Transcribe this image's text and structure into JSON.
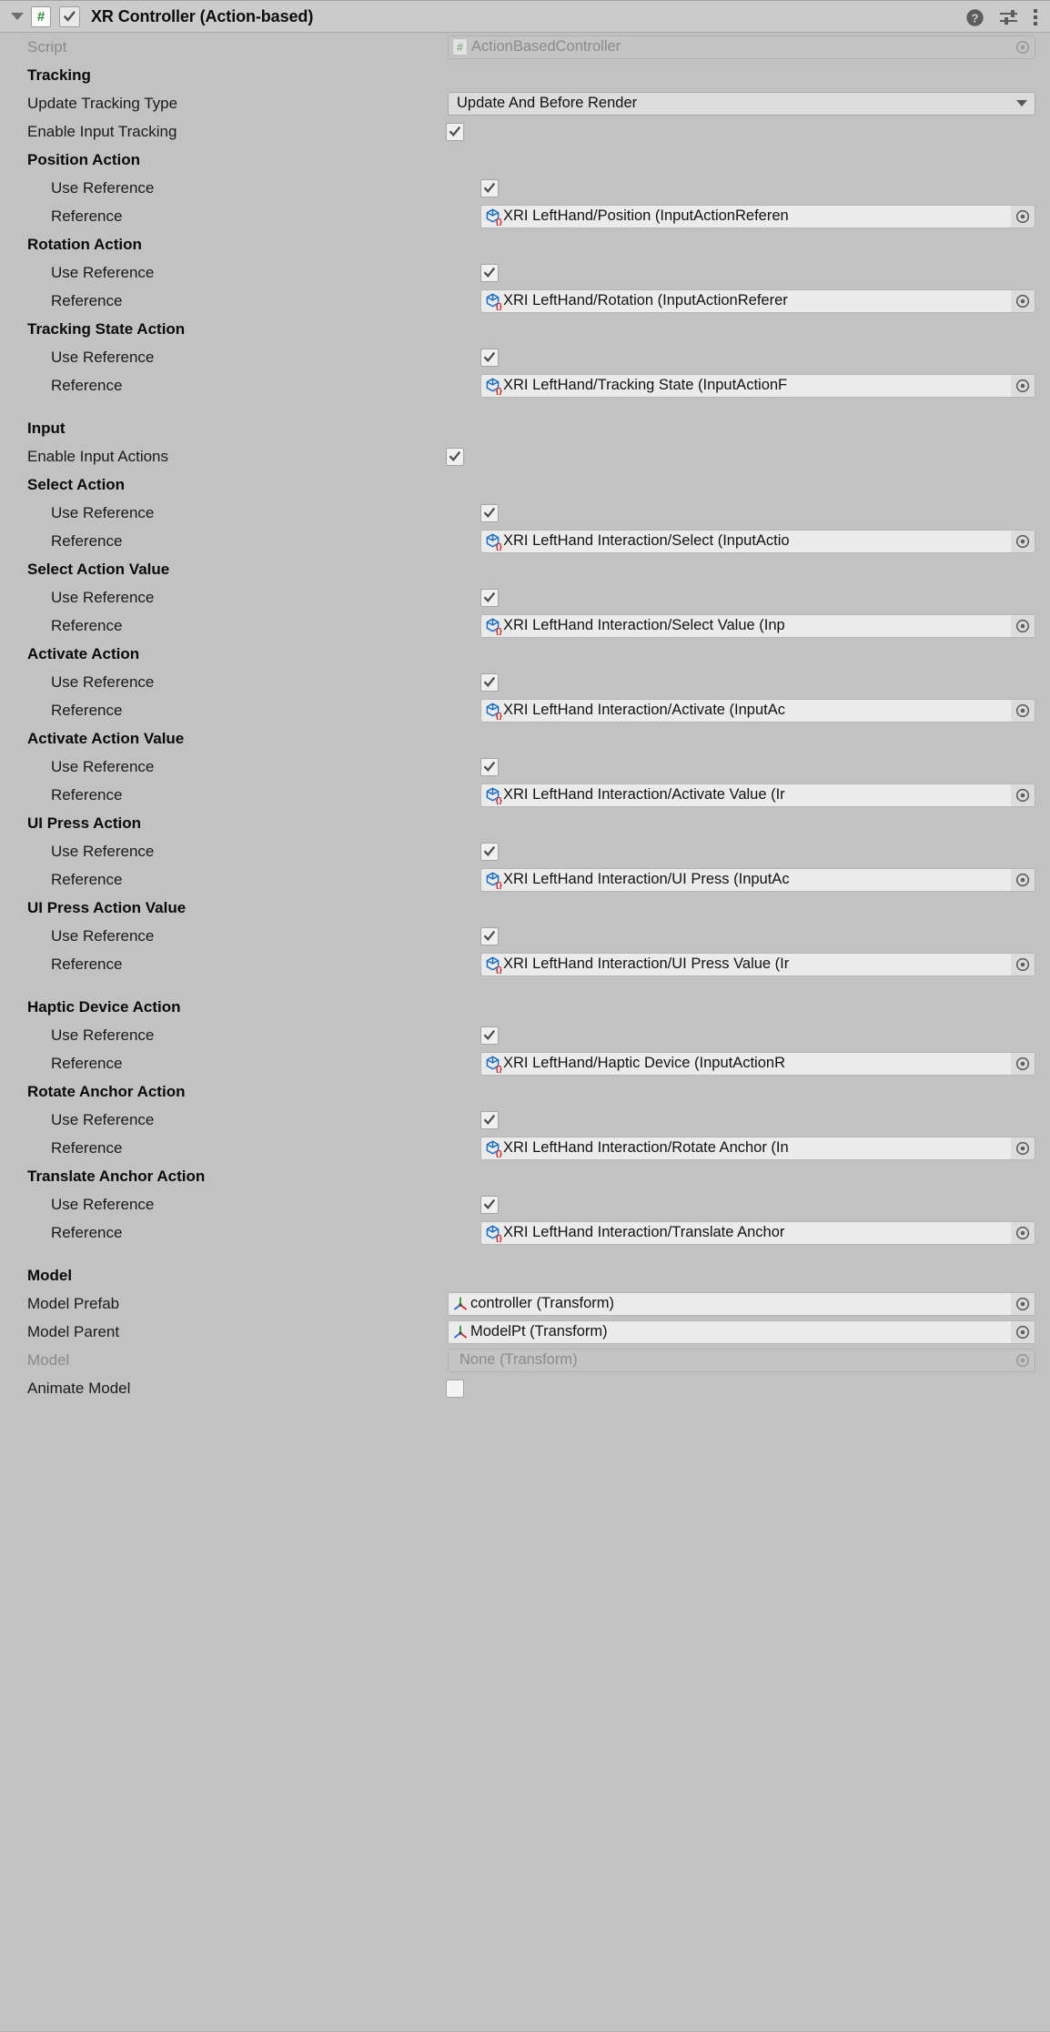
{
  "header": {
    "title": "XR Controller (Action-based)",
    "foldout_icon": "triangle-down-icon",
    "script_icon": "csharp-script-icon",
    "enabled_checked": true,
    "help_icon": "help-icon",
    "preset_icon": "preset-sliders-icon",
    "menu_icon": "kebab-menu-icon"
  },
  "script_row": {
    "label": "Script",
    "value": "ActionBasedController",
    "icon": "csharp-script-icon",
    "disabled": true
  },
  "sections": [
    {
      "title": "Tracking",
      "rows": [
        {
          "kind": "dropdown",
          "label": "Update Tracking Type",
          "value": "Update And Before Render"
        },
        {
          "kind": "checkbox",
          "label": "Enable Input Tracking",
          "checked": true,
          "indent": 0
        }
      ]
    },
    {
      "title": "Position Action",
      "rows": [
        {
          "kind": "checkbox",
          "label": "Use Reference",
          "checked": true,
          "indent": 1
        },
        {
          "kind": "object",
          "label": "Reference",
          "value": "XRI LeftHand/Position (InputActionReferen",
          "icon": "scriptable-object-icon",
          "indent": 1
        }
      ]
    },
    {
      "title": "Rotation Action",
      "rows": [
        {
          "kind": "checkbox",
          "label": "Use Reference",
          "checked": true,
          "indent": 1
        },
        {
          "kind": "object",
          "label": "Reference",
          "value": "XRI LeftHand/Rotation (InputActionReferer",
          "icon": "scriptable-object-icon",
          "indent": 1
        }
      ]
    },
    {
      "title": "Tracking State Action",
      "rows": [
        {
          "kind": "checkbox",
          "label": "Use Reference",
          "checked": true,
          "indent": 1
        },
        {
          "kind": "object",
          "label": "Reference",
          "value": "XRI LeftHand/Tracking State (InputActionF",
          "icon": "scriptable-object-icon",
          "indent": 1
        }
      ]
    },
    {
      "title": "Input",
      "spacer_before": true,
      "rows": [
        {
          "kind": "checkbox",
          "label": "Enable Input Actions",
          "checked": true,
          "indent": 0
        }
      ]
    },
    {
      "title": "Select Action",
      "rows": [
        {
          "kind": "checkbox",
          "label": "Use Reference",
          "checked": true,
          "indent": 1
        },
        {
          "kind": "object",
          "label": "Reference",
          "value": "XRI LeftHand Interaction/Select (InputActio",
          "icon": "scriptable-object-icon",
          "indent": 1
        }
      ]
    },
    {
      "title": "Select Action Value",
      "rows": [
        {
          "kind": "checkbox",
          "label": "Use Reference",
          "checked": true,
          "indent": 1
        },
        {
          "kind": "object",
          "label": "Reference",
          "value": "XRI LeftHand Interaction/Select Value (Inp",
          "icon": "scriptable-object-icon",
          "indent": 1
        }
      ]
    },
    {
      "title": "Activate Action",
      "rows": [
        {
          "kind": "checkbox",
          "label": "Use Reference",
          "checked": true,
          "indent": 1
        },
        {
          "kind": "object",
          "label": "Reference",
          "value": "XRI LeftHand Interaction/Activate (InputAc",
          "icon": "scriptable-object-icon",
          "indent": 1
        }
      ]
    },
    {
      "title": "Activate Action Value",
      "rows": [
        {
          "kind": "checkbox",
          "label": "Use Reference",
          "checked": true,
          "indent": 1
        },
        {
          "kind": "object",
          "label": "Reference",
          "value": "XRI LeftHand Interaction/Activate Value (Ir",
          "icon": "scriptable-object-icon",
          "indent": 1
        }
      ]
    },
    {
      "title": "UI Press Action",
      "rows": [
        {
          "kind": "checkbox",
          "label": "Use Reference",
          "checked": true,
          "indent": 1
        },
        {
          "kind": "object",
          "label": "Reference",
          "value": "XRI LeftHand Interaction/UI Press (InputAc",
          "icon": "scriptable-object-icon",
          "indent": 1
        }
      ]
    },
    {
      "title": "UI Press Action Value",
      "rows": [
        {
          "kind": "checkbox",
          "label": "Use Reference",
          "checked": true,
          "indent": 1
        },
        {
          "kind": "object",
          "label": "Reference",
          "value": "XRI LeftHand Interaction/UI Press Value (Ir",
          "icon": "scriptable-object-icon",
          "indent": 1
        }
      ]
    },
    {
      "title": "Haptic Device Action",
      "spacer_before": true,
      "rows": [
        {
          "kind": "checkbox",
          "label": "Use Reference",
          "checked": true,
          "indent": 1
        },
        {
          "kind": "object",
          "label": "Reference",
          "value": "XRI LeftHand/Haptic Device (InputActionR",
          "icon": "scriptable-object-icon",
          "indent": 1
        }
      ]
    },
    {
      "title": "Rotate Anchor Action",
      "rows": [
        {
          "kind": "checkbox",
          "label": "Use Reference",
          "checked": true,
          "indent": 1
        },
        {
          "kind": "object",
          "label": "Reference",
          "value": "XRI LeftHand Interaction/Rotate Anchor (In",
          "icon": "scriptable-object-icon",
          "indent": 1
        }
      ]
    },
    {
      "title": "Translate Anchor Action",
      "rows": [
        {
          "kind": "checkbox",
          "label": "Use Reference",
          "checked": true,
          "indent": 1
        },
        {
          "kind": "object",
          "label": "Reference",
          "value": "XRI LeftHand Interaction/Translate Anchor",
          "icon": "scriptable-object-icon",
          "indent": 1
        }
      ]
    },
    {
      "title": "Model",
      "spacer_before": true,
      "rows": [
        {
          "kind": "object",
          "label": "Model Prefab",
          "value": "controller (Transform)",
          "icon": "transform-icon",
          "indent": 0
        },
        {
          "kind": "object",
          "label": "Model Parent",
          "value": "ModelPt (Transform)",
          "icon": "transform-icon",
          "indent": 0
        },
        {
          "kind": "object",
          "label": "Model",
          "value": "None (Transform)",
          "icon": "none-icon",
          "indent": 0,
          "disabled": true
        },
        {
          "kind": "checkbox",
          "label": "Animate Model",
          "checked": false,
          "indent": 0
        }
      ]
    }
  ],
  "colors": {
    "background": "#c2c2c2",
    "header_bg": "#cbcbcb",
    "field_bg": "#ebebeb",
    "dropdown_bg": "#dcdcdc",
    "accent_green": "#2f8f3f",
    "asset_blue": "#1a6fc4",
    "asset_red": "#cc2222"
  }
}
